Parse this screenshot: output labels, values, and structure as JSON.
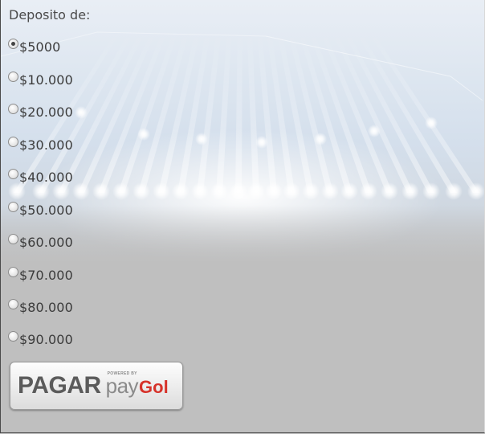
{
  "form": {
    "legend": "Deposito de:",
    "options": [
      {
        "label": "$5000",
        "checked": true
      },
      {
        "label": "$10.000",
        "checked": false
      },
      {
        "label": "$20.000",
        "checked": false
      },
      {
        "label": "$30.000",
        "checked": false
      },
      {
        "label": "$40.000",
        "checked": false
      },
      {
        "label": "$50.000",
        "checked": false
      },
      {
        "label": "$60.000",
        "checked": false
      },
      {
        "label": "$70.000",
        "checked": false
      },
      {
        "label": "$80.000",
        "checked": false
      },
      {
        "label": "$90.000",
        "checked": false
      }
    ]
  },
  "pay_button": {
    "label": "PAGAR",
    "powered_by": "POWERED BY",
    "brand_pay": "pay",
    "brand_gol": "Gol",
    "brand_color": "#d6322a"
  },
  "colors": {
    "panel_background": "#bfbfbf",
    "text": "#3b3b3b"
  },
  "background": {
    "image": "stadium-floodlights"
  }
}
